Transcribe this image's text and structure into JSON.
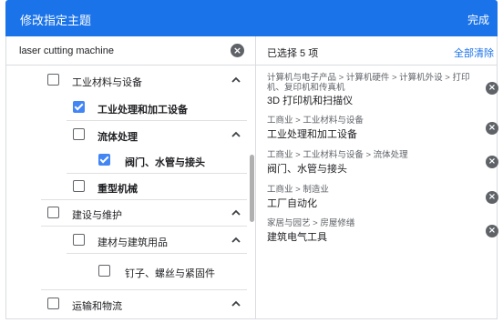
{
  "header": {
    "title": "修改指定主题",
    "done_label": "完成"
  },
  "search": {
    "value": "laser cutting machine",
    "clear_symbol": "×"
  },
  "tree": {
    "items": [
      {
        "label": "工业材料与设备",
        "checked": false,
        "expanded": true
      },
      {
        "label": "工业处理和加工设备",
        "checked": true
      },
      {
        "label": "流体处理",
        "checked": false,
        "expanded": true
      },
      {
        "label": "阀门、水管与接头",
        "checked": true
      },
      {
        "label": "重型机械",
        "checked": false
      },
      {
        "label": "建设与维护",
        "checked": false,
        "expanded": true
      },
      {
        "label": "建材与建筑用品",
        "checked": false,
        "expanded": true
      },
      {
        "label": "钉子、螺丝与紧固件",
        "checked": false
      },
      {
        "label": "运输和物流",
        "checked": false,
        "expanded": true
      }
    ],
    "expand_icon": "chevron-up-icon"
  },
  "selected": {
    "count_label": "已选择 5 项",
    "clear_all_label": "全部清除",
    "remove_symbol": "×",
    "items": [
      {
        "path": "计算机与电子产品 > 计算机硬件 > 计算机外设 > 打印机、复印机和传真机",
        "name": "3D 打印机和扫描仪"
      },
      {
        "path": "工商业 > 工业材料与设备",
        "name": "工业处理和加工设备"
      },
      {
        "path": "工商业 > 工业材料与设备 > 流体处理",
        "name": "阀门、水管与接头"
      },
      {
        "path": "工商业 > 制造业",
        "name": "工厂自动化"
      },
      {
        "path": "家居与园艺 > 房屋修缮",
        "name": "建筑电气工具"
      }
    ]
  },
  "colors": {
    "header_bg": "#1a73e8",
    "accent": "#1a73e8",
    "checkbox_checked": "#4285f4"
  }
}
